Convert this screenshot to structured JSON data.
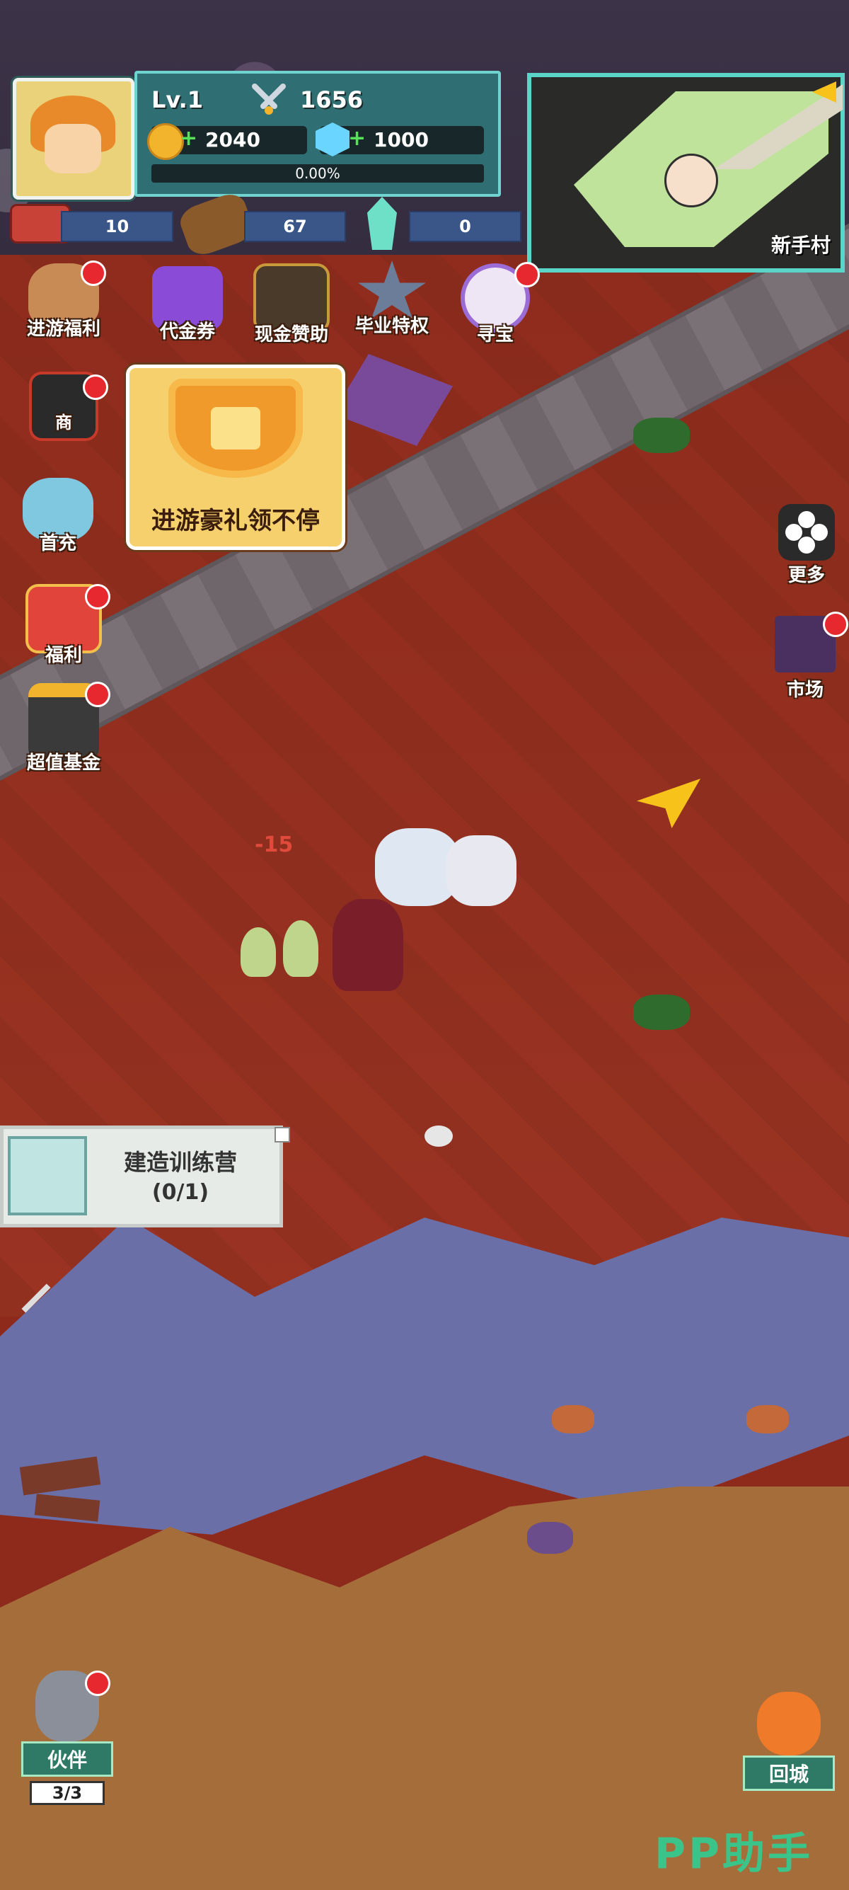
{
  "player": {
    "level": "Lv.1",
    "power": "1656",
    "gold": "2040",
    "gems": "1000",
    "exp_percent": "0.00%"
  },
  "materials": [
    {
      "name": "meat",
      "value": "10"
    },
    {
      "name": "wood",
      "value": "67"
    },
    {
      "name": "crystal",
      "value": "0"
    }
  ],
  "minimap": {
    "location": "新手村"
  },
  "top_menu": [
    {
      "id": "progress-welfare",
      "label": "进游福利"
    },
    {
      "id": "voucher",
      "label": "代金券"
    },
    {
      "id": "cash-sponsor",
      "label": "现金赞助"
    },
    {
      "id": "graduation-privilege",
      "label": "毕业特权"
    },
    {
      "id": "treasure-hunt",
      "label": "寻宝"
    }
  ],
  "side_menu": [
    {
      "id": "shop",
      "label": "商"
    },
    {
      "id": "first-recharge",
      "label": "首充"
    },
    {
      "id": "welfare",
      "label": "福利"
    },
    {
      "id": "value-fund",
      "label": "超值基金"
    }
  ],
  "gift_popup": {
    "text": "进游豪礼领不停"
  },
  "right_menu": {
    "more": "更多",
    "market": "市场"
  },
  "battle": {
    "damage_text": "-15"
  },
  "quest": {
    "title": "建造训练营",
    "progress": "(0/1)"
  },
  "bottom": {
    "partner": "伙伴",
    "partner_count": "3/3",
    "city": "回城"
  },
  "watermark": "PP助手",
  "colors": {
    "accent": "#5ad6c8",
    "alert": "#e8282f",
    "ground": "#8f2c1d",
    "water": "#6a6fa8"
  }
}
